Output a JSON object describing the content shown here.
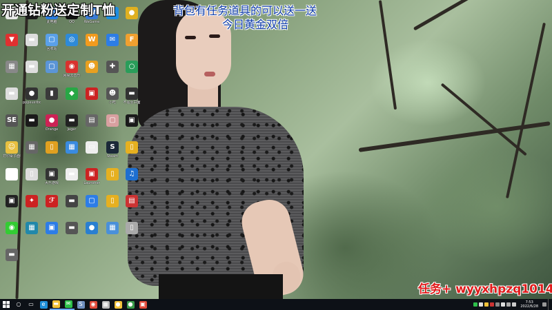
{
  "overlay": {
    "top_left": "开通钻粉送定制T恤",
    "center_line1": "背包有任务道具的可以送一送",
    "center_line2": "今日黄金双倍",
    "bottom_right": "任务+ wyyxhpzq1014"
  },
  "desktop_icons": [
    {
      "label": "",
      "color": "#e8e8e8",
      "glyph": ""
    },
    {
      "label": "",
      "color": "#1a1a1a",
      "glyph": ""
    },
    {
      "label": "此电脑",
      "color": "#2b7de0",
      "glyph": "▭"
    },
    {
      "label": "QQ",
      "color": "#111",
      "glyph": "Q"
    },
    {
      "label": "WeGame",
      "color": "#3a7bd5",
      "glyph": "W"
    },
    {
      "label": "",
      "color": "#1e8de0",
      "glyph": "↑"
    },
    {
      "label": "",
      "color": "#e0b020",
      "glyph": "●"
    },
    {
      "label": "",
      "color": "#e03030",
      "glyph": "▼"
    },
    {
      "label": "",
      "color": "#ddd",
      "glyph": "▬"
    },
    {
      "label": "回收站",
      "color": "#5aa0e8",
      "glyph": "▢"
    },
    {
      "label": "",
      "color": "#2e8ad8",
      "glyph": "◎"
    },
    {
      "label": "",
      "color": "#f29b1e",
      "glyph": "W"
    },
    {
      "label": "",
      "color": "#2d7de6",
      "glyph": "✉"
    },
    {
      "label": "",
      "color": "#f0a030",
      "glyph": "F"
    },
    {
      "label": "",
      "color": "#888",
      "glyph": "▦"
    },
    {
      "label": "",
      "color": "#ddd",
      "glyph": "▬"
    },
    {
      "label": "",
      "color": "#5b95d6",
      "glyph": "▢"
    },
    {
      "label": "网易云音乐",
      "color": "#d9322e",
      "glyph": "◉"
    },
    {
      "label": "",
      "color": "#e8a020",
      "glyph": "☻"
    },
    {
      "label": "",
      "color": "#555",
      "glyph": "✚"
    },
    {
      "label": "",
      "color": "#2a9d5a",
      "glyph": "○"
    },
    {
      "label": "",
      "color": "#ddd",
      "glyph": "▬"
    },
    {
      "label": "pppxuxtbox1xs",
      "color": "#333",
      "glyph": "●"
    },
    {
      "label": "",
      "color": "#3a3a3a",
      "glyph": "▮"
    },
    {
      "label": "",
      "color": "#28a745",
      "glyph": "◆"
    },
    {
      "label": "",
      "color": "#cc2222",
      "glyph": "▣"
    },
    {
      "label": "小吃",
      "color": "#555",
      "glyph": "☻"
    },
    {
      "label": "不遥至书面",
      "color": "#333",
      "glyph": "▬"
    },
    {
      "label": "",
      "color": "#555",
      "glyph": "SE"
    },
    {
      "label": "",
      "color": "#1a1a1a",
      "glyph": "▬"
    },
    {
      "label": "Orange",
      "color": "#c25",
      "glyph": "●"
    },
    {
      "label": "Jeger",
      "color": "#222",
      "glyph": "▬"
    },
    {
      "label": "",
      "color": "#666",
      "glyph": "▤"
    },
    {
      "label": "",
      "color": "#d8a0a0",
      "glyph": "▢"
    },
    {
      "label": "",
      "color": "#1a1a1a",
      "glyph": "▣"
    },
    {
      "label": "打印桌子面板",
      "color": "#e8c040",
      "glyph": "☺"
    },
    {
      "label": "",
      "color": "#666",
      "glyph": "▦"
    },
    {
      "label": "",
      "color": "#e0a020",
      "glyph": "▯"
    },
    {
      "label": "",
      "color": "#3a8be0",
      "glyph": "▦"
    },
    {
      "label": "",
      "color": "#eee",
      "glyph": "▭"
    },
    {
      "label": "Steam",
      "color": "#1b2838",
      "glyph": "S"
    },
    {
      "label": "",
      "color": "#e6b020",
      "glyph": "▯"
    },
    {
      "label": "",
      "color": "#fff",
      "glyph": "●"
    },
    {
      "label": "",
      "color": "#ddd",
      "glyph": "▯"
    },
    {
      "label": "大乐游戏",
      "color": "#333",
      "glyph": "▣"
    },
    {
      "label": "",
      "color": "#eee",
      "glyph": "▬"
    },
    {
      "label": "Launcher",
      "color": "#cc2222",
      "glyph": "▣"
    },
    {
      "label": "",
      "color": "#e6b020",
      "glyph": "▯"
    },
    {
      "label": "",
      "color": "#1e6fd0",
      "glyph": "♫"
    },
    {
      "label": "",
      "color": "#222",
      "glyph": "▣"
    },
    {
      "label": "",
      "color": "#c22",
      "glyph": "✦"
    },
    {
      "label": "",
      "color": "#c22",
      "glyph": "ℱ"
    },
    {
      "label": "",
      "color": "#444",
      "glyph": "▬"
    },
    {
      "label": "",
      "color": "#2d7de6",
      "glyph": "▢"
    },
    {
      "label": "",
      "color": "#e6b020",
      "glyph": "▯"
    },
    {
      "label": "",
      "color": "#c33",
      "glyph": "▤"
    },
    {
      "label": "",
      "color": "#3c3",
      "glyph": "◉"
    },
    {
      "label": "",
      "color": "#28a",
      "glyph": "▦"
    },
    {
      "label": "",
      "color": "#2d7de6",
      "glyph": "▣"
    },
    {
      "label": "",
      "color": "#555",
      "glyph": "▬"
    },
    {
      "label": "",
      "color": "#2a7fd0",
      "glyph": "●"
    },
    {
      "label": "",
      "color": "#4a90d9",
      "glyph": "▦"
    },
    {
      "label": "",
      "color": "#aaa",
      "glyph": "▯"
    },
    {
      "label": "",
      "color": "#666",
      "glyph": "▬"
    }
  ],
  "taskbar": {
    "start_icon": "windows-icon",
    "apps": [
      {
        "name": "search",
        "color": "#ffffff",
        "glyph": "○"
      },
      {
        "name": "task-view",
        "color": "#ffffff",
        "glyph": "▭"
      },
      {
        "name": "edge",
        "color": "#1e8fd8",
        "glyph": "e"
      },
      {
        "name": "file-explorer",
        "color": "#f2c23a",
        "glyph": "▬"
      },
      {
        "name": "wechat",
        "color": "#2dbf4a",
        "glyph": "✉"
      },
      {
        "name": "steam",
        "color": "#6f8fbf",
        "glyph": "S"
      },
      {
        "name": "chrome",
        "color": "#e04a3a",
        "glyph": "◉"
      },
      {
        "name": "media",
        "color": "#bbb",
        "glyph": "▦"
      },
      {
        "name": "app",
        "color": "#f2c23a",
        "glyph": "●"
      },
      {
        "name": "app2",
        "color": "#3a9a4a",
        "glyph": "●"
      },
      {
        "name": "app3",
        "color": "#e04a3a",
        "glyph": "▣"
      }
    ],
    "clock_time": "7:53",
    "clock_date": "2022/6/28"
  }
}
